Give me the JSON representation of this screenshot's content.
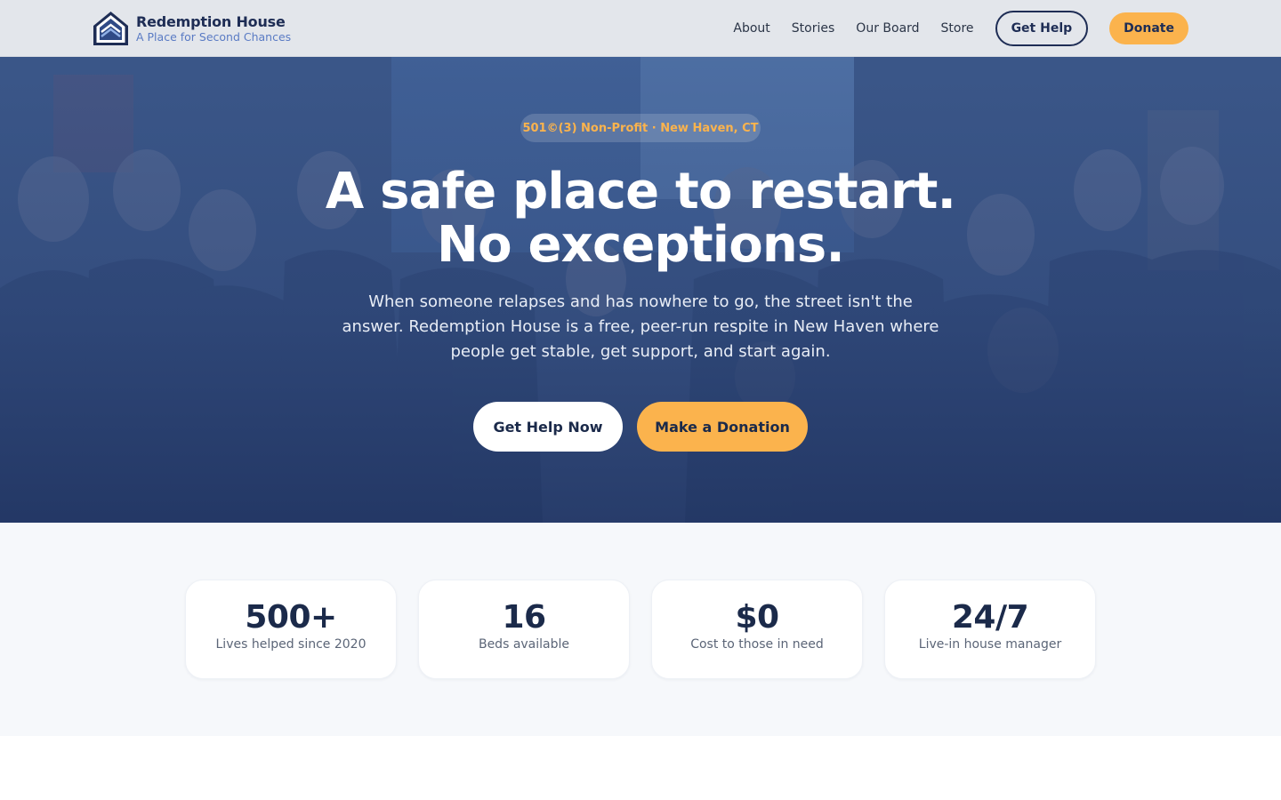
{
  "brand": {
    "name": "Redemption House",
    "tagline": "A Place for Second Chances",
    "logo_icon": "house-chevrons-icon"
  },
  "nav": {
    "links": [
      {
        "label": "About"
      },
      {
        "label": "Stories"
      },
      {
        "label": "Our Board"
      },
      {
        "label": "Store"
      }
    ],
    "get_help_label": "Get Help",
    "donate_label": "Donate"
  },
  "hero": {
    "badge": "501©(3) Non-Profit · New Haven, CT",
    "headline_line1": "A safe place to restart.",
    "headline_line2": "No exceptions.",
    "subtitle": "When someone relapses and has nowhere to go, the street isn't the answer. Redemption House is a free, peer-run respite in New Haven where people get stable, get support, and start again.",
    "primary_cta": "Get Help Now",
    "secondary_cta": "Make a Donation"
  },
  "stats": [
    {
      "value": "500+",
      "label": "Lives helped since 2020"
    },
    {
      "value": "16",
      "label": "Beds available"
    },
    {
      "value": "$0",
      "label": "Cost to those in need"
    },
    {
      "value": "24/7",
      "label": "Live-in house manager"
    }
  ],
  "colors": {
    "navy": "#1e2d55",
    "gold": "#fbb34d",
    "hero_blue": "#2c4677",
    "stats_bg": "#f6f8fb"
  }
}
